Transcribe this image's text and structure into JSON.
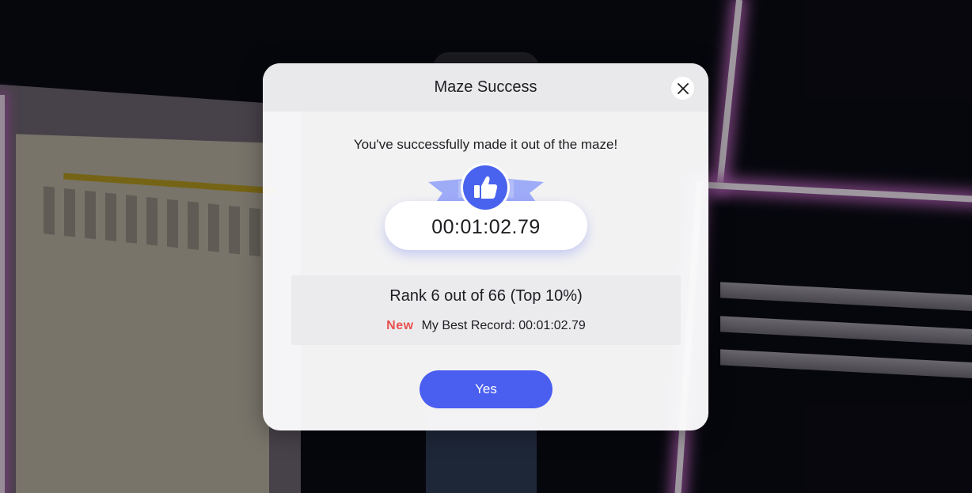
{
  "modal": {
    "title": "Maze Success",
    "close_icon": "close-icon",
    "message": "You've successfully made it out of the maze!",
    "badge_icon": "thumbs-up-icon",
    "time": "00:01:02.79",
    "rank_text": "Rank 6 out of 66 (Top 10%)",
    "new_label": "New",
    "best_record": "My Best Record: 00:01:02.79",
    "confirm_label": "Yes"
  },
  "colors": {
    "accent": "#4a5ef0",
    "ribbon": "#9eabf7",
    "new_badge": "#e8514f",
    "neon": "#c56cc9"
  }
}
